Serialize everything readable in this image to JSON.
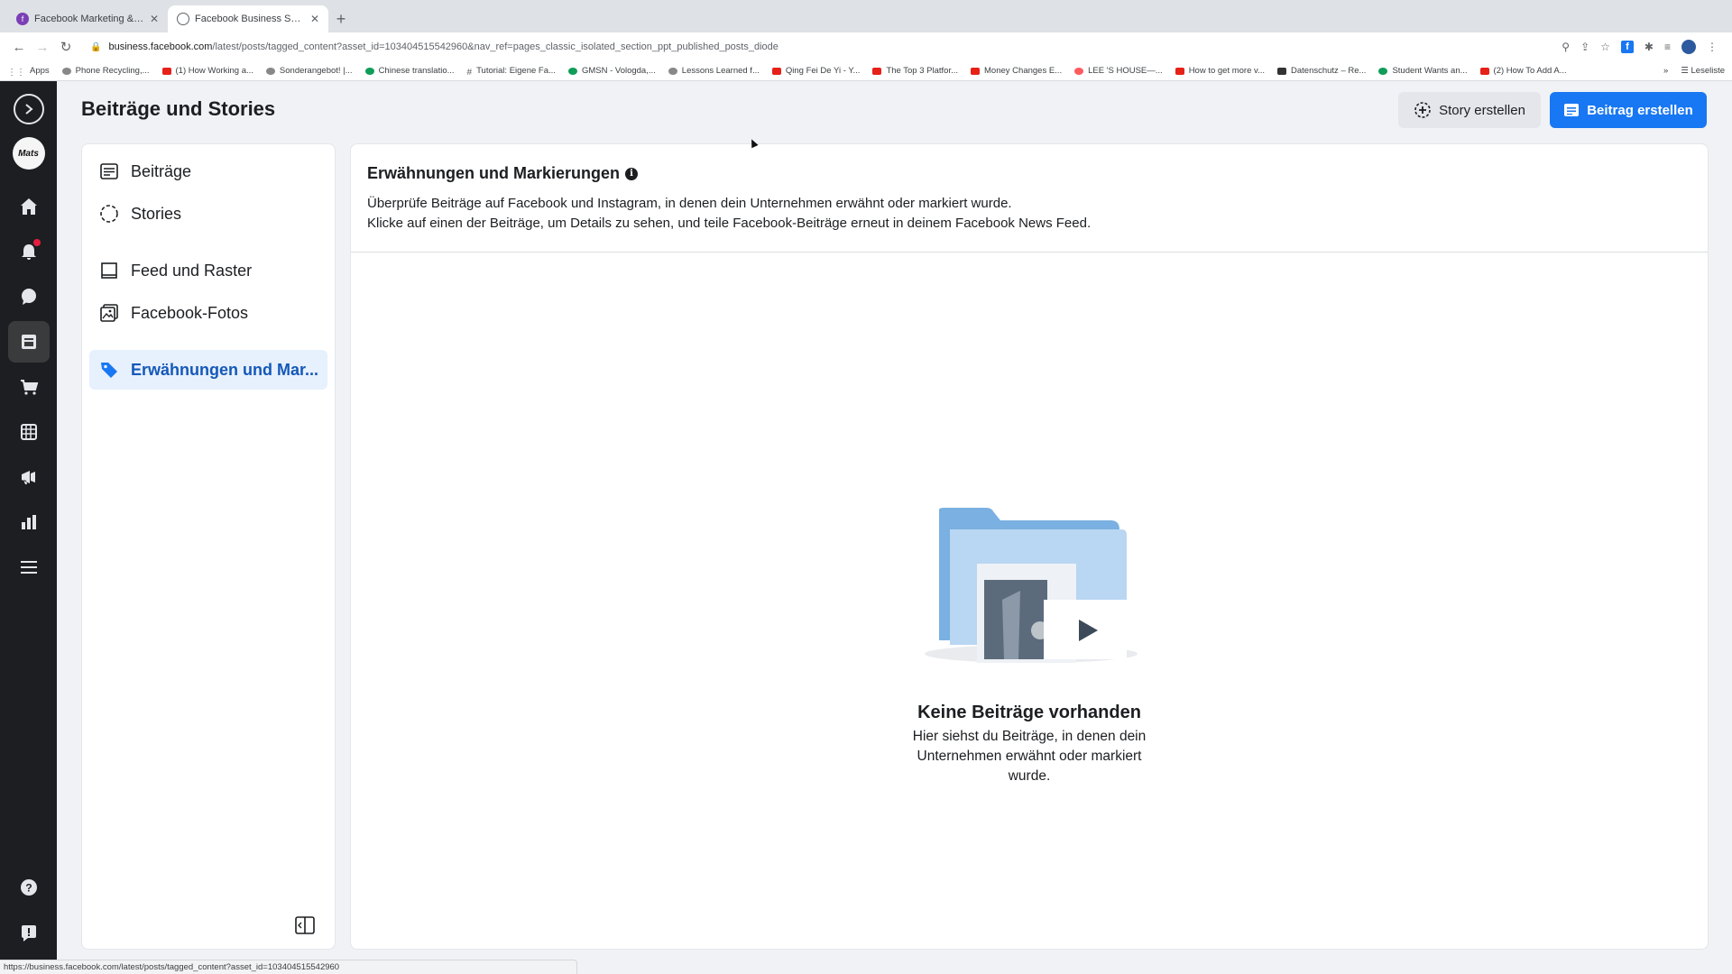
{
  "browser": {
    "tabs": [
      {
        "title": "Facebook Marketing & Werbea",
        "favicon": "purple-circle-icon",
        "active": false
      },
      {
        "title": "Facebook Business Suite",
        "favicon": "business-suite-icon",
        "active": true
      }
    ],
    "url_host": "business.facebook.com",
    "url_path": "/latest/posts/tagged_content?asset_id=103404515542960&nav_ref=pages_classic_isolated_section_ppt_published_posts_diode",
    "bookmarks": [
      "Apps",
      "Phone Recycling,...",
      "(1) How Working a...",
      "Sonderangebot! |...",
      "Chinese translatio...",
      "Tutorial: Eigene Fa...",
      "GMSN - Vologda,...",
      "Lessons Learned f...",
      "Qing Fei De Yi - Y...",
      "The Top 3 Platfor...",
      "Money Changes E...",
      "LEE 'S HOUSE—...",
      "How to get more v...",
      "Datenschutz – Re...",
      "Student Wants an...",
      "(2) How To Add A..."
    ],
    "reading_list": "Leseliste",
    "status_url": "https://business.facebook.com/latest/posts/tagged_content?asset_id=103404515542960"
  },
  "rail": {
    "avatar_text": "Mats",
    "items": [
      "home-icon",
      "notifications-icon",
      "inbox-icon",
      "posts-icon",
      "shop-icon",
      "planner-icon",
      "ads-icon",
      "insights-icon",
      "menu-icon"
    ],
    "bottom": [
      "help-icon",
      "feedback-icon"
    ]
  },
  "header": {
    "title": "Beiträge und Stories",
    "story_button": "Story erstellen",
    "post_button": "Beitrag erstellen"
  },
  "sidebar": {
    "items": [
      {
        "label": "Beiträge",
        "icon": "posts-list-icon"
      },
      {
        "label": "Stories",
        "icon": "stories-circle-icon"
      },
      {
        "label": "Feed und Raster",
        "icon": "feed-grid-icon"
      },
      {
        "label": "Facebook-Fotos",
        "icon": "photos-icon"
      },
      {
        "label": "Erwähnungen und Mar...",
        "icon": "tag-icon",
        "selected": true
      }
    ]
  },
  "main": {
    "title": "Erwähnungen und Markierungen",
    "desc_line1": "Überprüfe Beiträge auf Facebook und Instagram, in denen dein Unternehmen erwähnt oder markiert wurde.",
    "desc_line2": "Klicke auf einen der Beiträge, um Details zu sehen, und teile Facebook-Beiträge erneut in deinem Facebook News Feed.",
    "empty_title": "Keine Beiträge vorhanden",
    "empty_text": "Hier siehst du Beiträge, in denen dein Unternehmen erwähnt oder markiert wurde."
  },
  "colors": {
    "accent": "#1877f2",
    "rail_bg": "#1c1e21",
    "selected_bg": "#e7f0fd",
    "selected_text": "#1458b8"
  }
}
